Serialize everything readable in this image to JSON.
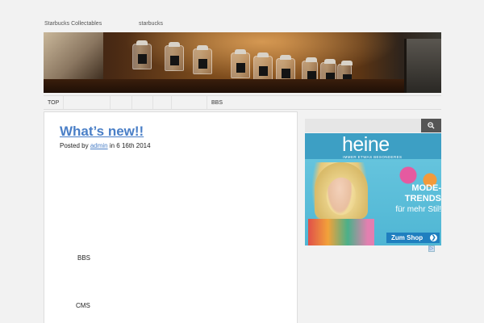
{
  "header": {
    "site_title": "Starbucks Collectables",
    "site_description": "starbucks"
  },
  "nav": {
    "items": [
      {
        "label": "TOP"
      },
      {
        "label": ""
      },
      {
        "label": ""
      },
      {
        "label": ""
      },
      {
        "label": ""
      },
      {
        "label": ""
      },
      {
        "label": "BBS"
      }
    ]
  },
  "post": {
    "title": "What’s new!!",
    "meta_prefix": "Posted by",
    "author": "admin",
    "meta_date": "in 6  16th 2014",
    "lines": [
      "BBS",
      "CMS"
    ]
  },
  "sidebar": {
    "search_icon": "magnifier-icon",
    "ad": {
      "brand": "heine",
      "tagline": "IMMER ETWAS BESONDERES",
      "headline_1": "MODE-",
      "headline_2": "TRENDS",
      "subline": "für mehr Stil!",
      "cta": "Zum Shop",
      "cta_icon": "arrow-right-icon",
      "info_icon": "ad-info-icon"
    }
  },
  "colors": {
    "link": "#4a7fc7",
    "ad_blue": "#3d9fc4",
    "background": "#f2f2f2"
  }
}
